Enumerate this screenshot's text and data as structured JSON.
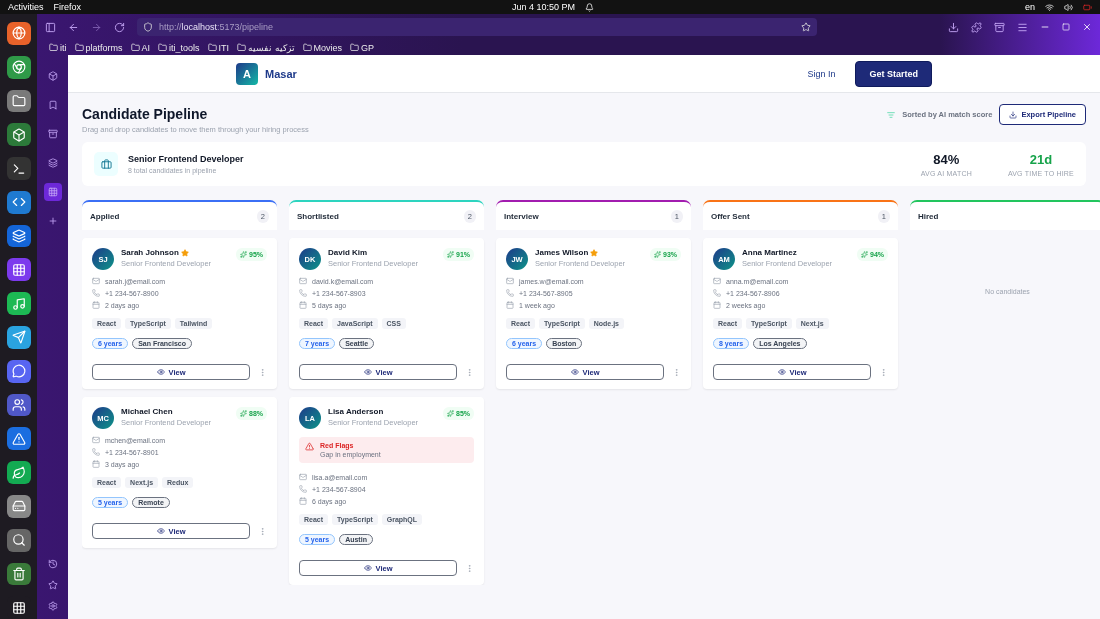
{
  "system_bar": {
    "activities": "Activities",
    "app": "Firefox",
    "clock": "Jun 4  10:50 PM",
    "language": "en"
  },
  "browser": {
    "url_prefix": "http://",
    "url_host": "localhost",
    "url_rest": ":5173/pipeline",
    "bookmarks": [
      "iti",
      "platforms",
      "AI",
      "iti_tools",
      "ITI",
      "تزكيه نفسيه",
      "Movies",
      "GP"
    ]
  },
  "navbar": {
    "logo_letter": "A",
    "brand": "Masar",
    "sign_in": "Sign In",
    "get_started": "Get Started"
  },
  "header": {
    "title": "Candidate Pipeline",
    "subtitle": "Drag and drop candidates to move them through your hiring process",
    "sort_note": "Sorted by AI match score",
    "export": "Export Pipeline"
  },
  "summary": {
    "job": "Senior Frontend Developer",
    "total": "8 total candidates in pipeline",
    "stats": [
      {
        "value": "84%",
        "label": "AVG AI MATCH",
        "color": "#111827"
      },
      {
        "value": "21d",
        "label": "AVG TIME TO HIRE",
        "color": "#16a34a"
      }
    ]
  },
  "columns": [
    {
      "title": "Applied",
      "count": "2",
      "color": "#3b6ff5",
      "candidates": [
        {
          "initials": "SJ",
          "name": "Sarah Johnson",
          "starred": true,
          "role": "Senior Frontend Developer",
          "score": "95%",
          "contacts": [
            {
              "kind": "email",
              "text": "sarah.j@email.com"
            },
            {
              "kind": "phone",
              "text": "+1 234-567-8900"
            },
            {
              "kind": "date",
              "text": "2 days ago"
            }
          ],
          "skills": [
            "React",
            "TypeScript",
            "Tailwind"
          ],
          "experience": "6 years",
          "location": "San Francisco",
          "view": "View"
        },
        {
          "initials": "MC",
          "name": "Michael Chen",
          "starred": false,
          "role": "Senior Frontend Developer",
          "score": "88%",
          "contacts": [
            {
              "kind": "email",
              "text": "mchen@email.com"
            },
            {
              "kind": "phone",
              "text": "+1 234-567-8901"
            },
            {
              "kind": "date",
              "text": "3 days ago"
            }
          ],
          "skills": [
            "React",
            "Next.js",
            "Redux"
          ],
          "experience": "5 years",
          "location": "Remote",
          "view": "View"
        }
      ]
    },
    {
      "title": "Shortlisted",
      "count": "2",
      "color": "#2dd4bf",
      "candidates": [
        {
          "initials": "DK",
          "name": "David Kim",
          "starred": false,
          "role": "Senior Frontend Developer",
          "score": "91%",
          "contacts": [
            {
              "kind": "email",
              "text": "david.k@email.com"
            },
            {
              "kind": "phone",
              "text": "+1 234-567-8903"
            },
            {
              "kind": "date",
              "text": "5 days ago"
            }
          ],
          "skills": [
            "React",
            "JavaScript",
            "CSS"
          ],
          "experience": "7 years",
          "location": "Seattle",
          "view": "View"
        },
        {
          "initials": "LA",
          "name": "Lisa Anderson",
          "starred": false,
          "role": "Senior Frontend Developer",
          "score": "85%",
          "red_flags": {
            "title": "Red Flags",
            "detail": "Gap in employment"
          },
          "contacts": [
            {
              "kind": "email",
              "text": "lisa.a@email.com"
            },
            {
              "kind": "phone",
              "text": "+1 234-567-8904"
            },
            {
              "kind": "date",
              "text": "6 days ago"
            }
          ],
          "skills": [
            "React",
            "TypeScript",
            "GraphQL"
          ],
          "experience": "5 years",
          "location": "Austin",
          "view": "View"
        }
      ]
    },
    {
      "title": "Interview",
      "count": "1",
      "color": "#a21caf",
      "candidates": [
        {
          "initials": "JW",
          "name": "James Wilson",
          "starred": true,
          "role": "Senior Frontend Developer",
          "score": "93%",
          "contacts": [
            {
              "kind": "email",
              "text": "james.w@email.com"
            },
            {
              "kind": "phone",
              "text": "+1 234-567-8905"
            },
            {
              "kind": "date",
              "text": "1 week ago"
            }
          ],
          "skills": [
            "React",
            "TypeScript",
            "Node.js"
          ],
          "experience": "6 years",
          "location": "Boston",
          "view": "View"
        }
      ]
    },
    {
      "title": "Offer Sent",
      "count": "1",
      "color": "#f97316",
      "candidates": [
        {
          "initials": "AM",
          "name": "Anna Martinez",
          "starred": false,
          "role": "Senior Frontend Developer",
          "score": "94%",
          "contacts": [
            {
              "kind": "email",
              "text": "anna.m@email.com"
            },
            {
              "kind": "phone",
              "text": "+1 234-567-8906"
            },
            {
              "kind": "date",
              "text": "2 weeks ago"
            }
          ],
          "skills": [
            "React",
            "TypeScript",
            "Next.js"
          ],
          "experience": "8 years",
          "location": "Los Angeles",
          "view": "View"
        }
      ]
    },
    {
      "title": "Hired",
      "color": "#22c55e",
      "empty": "No candidates"
    }
  ]
}
